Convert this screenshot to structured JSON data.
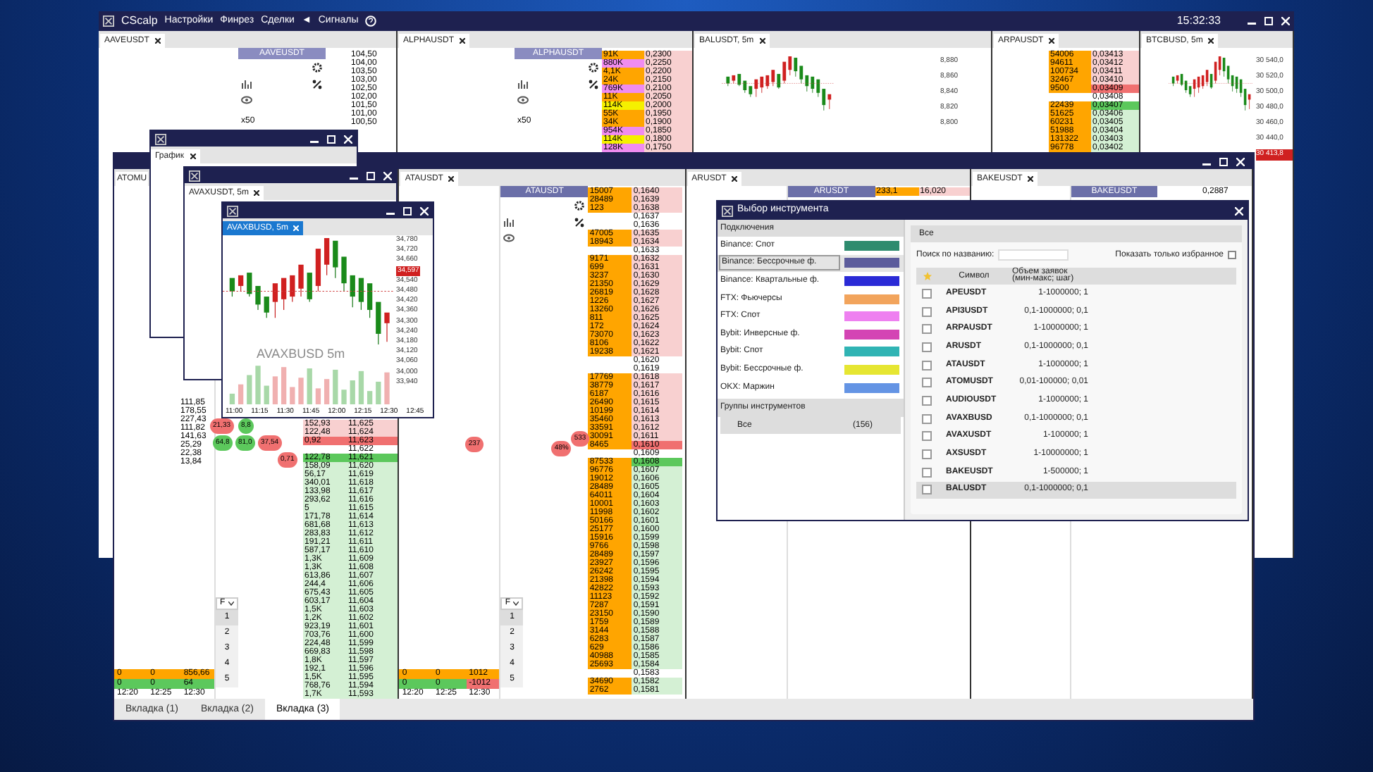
{
  "app": {
    "title": "CScalp",
    "menu": [
      "Настройки",
      "Финрез",
      "Сделки",
      "◄",
      "Сигналы"
    ],
    "time": "15:32:33"
  },
  "back_panes": [
    {
      "tab": "AAVEUSDT",
      "header": "AAVEUSDT",
      "multiplier": "x50",
      "prices": [
        "104,50",
        "104,00",
        "103,50",
        "103,00",
        "102,50",
        "102,00",
        "101,50",
        "101,00",
        "100,50"
      ]
    },
    {
      "tab": "ALPHAUSDT",
      "header": "ALPHAUSDT",
      "multiplier": "x50",
      "book": [
        {
          "volume": "91K",
          "price": "0,2300",
          "kind": "ask",
          "color": "#ffa500"
        },
        {
          "volume": "880K",
          "price": "0,2250",
          "kind": "ask",
          "color": "#f08cf0"
        },
        {
          "volume": "4,1K",
          "price": "0,2200",
          "kind": "ask",
          "color": "#ffa500"
        },
        {
          "volume": "24K",
          "price": "0,2150",
          "kind": "ask",
          "color": "#ffa500"
        },
        {
          "volume": "769K",
          "price": "0,2100",
          "kind": "ask",
          "color": "#f08cf0"
        },
        {
          "volume": "11K",
          "price": "0,2050",
          "kind": "ask",
          "color": "#ffa500"
        },
        {
          "volume": "114K",
          "price": "0,2000",
          "kind": "ask",
          "color": "#f5f000"
        },
        {
          "volume": "55K",
          "price": "0,1950",
          "kind": "ask",
          "color": "#ffa500"
        },
        {
          "volume": "34K",
          "price": "0,1900",
          "kind": "ask",
          "color": "#ffa500"
        },
        {
          "volume": "954K",
          "price": "0,1850",
          "kind": "ask",
          "color": "#f08cf0"
        },
        {
          "volume": "114K",
          "price": "0,1800",
          "kind": "ask",
          "color": "#f5f000"
        },
        {
          "volume": "128K",
          "price": "0,1750",
          "kind": "ask",
          "color": "#f08cf0"
        }
      ]
    },
    {
      "tab": "BALUSDT, 5m",
      "axis": [
        "8,880",
        "8,860",
        "8,840",
        "8,820",
        "8,800"
      ]
    },
    {
      "tab": "ARPAUSDT",
      "book": [
        {
          "volume": "54006",
          "price": "0,03413",
          "kind": "ask",
          "color": "#ffa500"
        },
        {
          "volume": "94611",
          "price": "0,03412",
          "kind": "ask",
          "color": "#ffa500"
        },
        {
          "volume": "100734",
          "price": "0,03411",
          "kind": "ask",
          "color": "#ffa500"
        },
        {
          "volume": "32467",
          "price": "0,03410",
          "kind": "ask",
          "color": "#ffa500"
        },
        {
          "volume": "9500",
          "price": "0,03409",
          "kind": "best_ask",
          "color": "#ffa500"
        },
        {
          "price": "0,03408",
          "kind": "empty"
        },
        {
          "volume": "22439",
          "price": "0,03407",
          "kind": "best_bid",
          "color": "#ffa500"
        },
        {
          "volume": "51625",
          "price": "0,03406",
          "kind": "bid",
          "color": "#ffa500"
        },
        {
          "volume": "60231",
          "price": "0,03405",
          "kind": "bid",
          "color": "#ffa500"
        },
        {
          "volume": "51988",
          "price": "0,03404",
          "kind": "bid",
          "color": "#ffa500"
        },
        {
          "volume": "131322",
          "price": "0,03403",
          "kind": "bid",
          "color": "#ffa500"
        },
        {
          "volume": "96778",
          "price": "0,03402",
          "kind": "bid",
          "color": "#ffa500"
        }
      ]
    },
    {
      "tab": "BTCBUSD, 5m",
      "axis": [
        "30 540,0",
        "30 520,0",
        "30 500,0",
        "30 480,0",
        "30 460,0",
        "30 440,0"
      ],
      "marker": "30 413,8"
    }
  ],
  "front_panes": [
    {
      "tab": "ATOMU",
      "filter": "F",
      "levels": [
        "1",
        "2",
        "3",
        "4",
        "5"
      ],
      "stats": [
        "111,85",
        "178,55",
        "227,43",
        "111,82",
        "141,63",
        "25,29",
        "22,38",
        "13,84"
      ],
      "bubbles": [
        {
          "text": "21,33",
          "color": "#f07070"
        },
        {
          "text": "64,8",
          "color": "#5cc85c"
        },
        {
          "text": "81,0",
          "color": "#5cc85c"
        },
        {
          "text": "8,8",
          "color": "#5cc85c"
        },
        {
          "text": "37,54",
          "color": "#f07070"
        },
        {
          "text": "0,71",
          "color": "#f07070"
        }
      ],
      "cluster": [
        {
          "kind": "sell",
          "values": [
            "0",
            "0",
            "856,66"
          ]
        },
        {
          "kind": "buy",
          "values": [
            "0",
            "0",
            "64"
          ]
        }
      ],
      "times": [
        "12:20",
        "12:25",
        "12:30"
      ],
      "book": [
        {
          "volume": "152,93",
          "price": "11,625",
          "kind": "ask"
        },
        {
          "volume": "122,48",
          "price": "11,624",
          "kind": "ask"
        },
        {
          "volume": "0,92",
          "price": "11,623",
          "kind": "best_ask"
        },
        {
          "price": "11,622",
          "kind": "empty"
        },
        {
          "volume": "122,78",
          "price": "11,621",
          "kind": "best_bid"
        },
        {
          "volume": "158,09",
          "price": "11,620",
          "kind": "bid"
        },
        {
          "volume": "56,17",
          "price": "11,619",
          "kind": "bid"
        },
        {
          "volume": "340,01",
          "price": "11,618",
          "kind": "bid"
        },
        {
          "volume": "133,98",
          "price": "11,617",
          "kind": "bid"
        },
        {
          "volume": "293,62",
          "price": "11,616",
          "kind": "bid"
        },
        {
          "volume": "5",
          "price": "11,615",
          "kind": "bid"
        },
        {
          "volume": "171,78",
          "price": "11,614",
          "kind": "bid"
        },
        {
          "volume": "681,68",
          "price": "11,613",
          "kind": "bid"
        },
        {
          "volume": "283,83",
          "price": "11,612",
          "kind": "bid"
        },
        {
          "volume": "191,21",
          "price": "11,611",
          "kind": "bid"
        },
        {
          "volume": "587,17",
          "price": "11,610",
          "kind": "bid"
        },
        {
          "volume": "1,3K",
          "price": "11,609",
          "kind": "bid"
        },
        {
          "volume": "1,3K",
          "price": "11,608",
          "kind": "bid"
        },
        {
          "volume": "613,86",
          "price": "11,607",
          "kind": "bid"
        },
        {
          "volume": "244,4",
          "price": "11,606",
          "kind": "bid"
        },
        {
          "volume": "675,43",
          "price": "11,605",
          "kind": "bid"
        },
        {
          "volume": "603,17",
          "price": "11,604",
          "kind": "bid"
        },
        {
          "volume": "1,5K",
          "price": "11,603",
          "kind": "bid"
        },
        {
          "volume": "1,2K",
          "price": "11,602",
          "kind": "bid"
        },
        {
          "volume": "923,19",
          "price": "11,601",
          "kind": "bid"
        },
        {
          "volume": "703,76",
          "price": "11,600",
          "kind": "bid"
        },
        {
          "volume": "224,48",
          "price": "11,599",
          "kind": "bid"
        },
        {
          "volume": "669,83",
          "price": "11,598",
          "kind": "bid"
        },
        {
          "volume": "1,8K",
          "price": "11,597",
          "kind": "bid"
        },
        {
          "volume": "192,1",
          "price": "11,596",
          "kind": "bid"
        },
        {
          "volume": "1,5K",
          "price": "11,595",
          "kind": "bid"
        },
        {
          "volume": "768,76",
          "price": "11,594",
          "kind": "bid"
        },
        {
          "volume": "1,7K",
          "price": "11,593",
          "kind": "bid"
        }
      ]
    },
    {
      "tab": "ATAUSDT",
      "header": "ATAUSDT",
      "filter": "F",
      "levels": [
        "1",
        "2",
        "3",
        "4",
        "5"
      ],
      "cluster": [
        {
          "kind": "sell",
          "values": [
            "0",
            "0",
            "1012"
          ]
        },
        {
          "kind": "buy",
          "values": [
            "0",
            "0",
            "-1012"
          ]
        }
      ],
      "times": [
        "12:20",
        "12:25",
        "12:30"
      ],
      "bubbles": [
        {
          "text": "237",
          "color": "#f07070"
        },
        {
          "text": "48%",
          "color": "#f07070"
        },
        {
          "text": "533",
          "color": "#f07070"
        }
      ],
      "book": [
        {
          "volume": "15007",
          "price": "0,1640",
          "kind": "ask",
          "color": "#ffa500"
        },
        {
          "volume": "28489",
          "price": "0,1639",
          "kind": "ask",
          "color": "#ffa500"
        },
        {
          "volume": "123",
          "price": "0,1638",
          "kind": "ask",
          "color": "#ffa500"
        },
        {
          "price": "0,1637",
          "kind": "empty"
        },
        {
          "price": "0,1636",
          "kind": "empty"
        },
        {
          "volume": "47005",
          "price": "0,1635",
          "kind": "ask",
          "color": "#ffa500"
        },
        {
          "volume": "18943",
          "price": "0,1634",
          "kind": "ask",
          "color": "#ffa500"
        },
        {
          "price": "0,1633",
          "kind": "empty"
        },
        {
          "volume": "9171",
          "price": "0,1632",
          "kind": "ask",
          "color": "#ffa500"
        },
        {
          "volume": "699",
          "price": "0,1631",
          "kind": "ask",
          "color": "#ffa500"
        },
        {
          "volume": "3237",
          "price": "0,1630",
          "kind": "ask",
          "color": "#ffa500"
        },
        {
          "volume": "21350",
          "price": "0,1629",
          "kind": "ask",
          "color": "#ffa500"
        },
        {
          "volume": "26819",
          "price": "0,1628",
          "kind": "ask",
          "color": "#ffa500"
        },
        {
          "volume": "1226",
          "price": "0,1627",
          "kind": "ask",
          "color": "#ffa500"
        },
        {
          "volume": "13260",
          "price": "0,1626",
          "kind": "ask",
          "color": "#ffa500"
        },
        {
          "volume": "811",
          "price": "0,1625",
          "kind": "ask",
          "color": "#ffa500"
        },
        {
          "volume": "172",
          "price": "0,1624",
          "kind": "ask",
          "color": "#ffa500"
        },
        {
          "volume": "73070",
          "price": "0,1623",
          "kind": "ask",
          "color": "#ffa500"
        },
        {
          "volume": "8106",
          "price": "0,1622",
          "kind": "ask",
          "color": "#ffa500"
        },
        {
          "volume": "19238",
          "price": "0,1621",
          "kind": "ask",
          "color": "#ffa500"
        },
        {
          "price": "0,1620",
          "kind": "empty"
        },
        {
          "price": "0,1619",
          "kind": "empty"
        },
        {
          "volume": "17769",
          "price": "0,1618",
          "kind": "ask",
          "color": "#ffa500"
        },
        {
          "volume": "38779",
          "price": "0,1617",
          "kind": "ask",
          "color": "#ffa500"
        },
        {
          "volume": "6187",
          "price": "0,1616",
          "kind": "ask",
          "color": "#ffa500"
        },
        {
          "volume": "26490",
          "price": "0,1615",
          "kind": "ask",
          "color": "#ffa500"
        },
        {
          "volume": "10199",
          "price": "0,1614",
          "kind": "ask",
          "color": "#ffa500"
        },
        {
          "volume": "35460",
          "price": "0,1613",
          "kind": "ask",
          "color": "#ffa500"
        },
        {
          "volume": "33591",
          "price": "0,1612",
          "kind": "ask",
          "color": "#ffa500"
        },
        {
          "volume": "30091",
          "price": "0,1611",
          "kind": "ask",
          "color": "#ffa500"
        },
        {
          "volume": "8465",
          "price": "0,1610",
          "kind": "best_ask",
          "color": "#ffa500"
        },
        {
          "price": "0,1609",
          "kind": "empty"
        },
        {
          "volume": "87533",
          "price": "0,1608",
          "kind": "best_bid",
          "color": "#ffa500"
        },
        {
          "volume": "96776",
          "price": "0,1607",
          "kind": "bid",
          "color": "#ffa500"
        },
        {
          "volume": "19012",
          "price": "0,1606",
          "kind": "bid",
          "color": "#ffa500"
        },
        {
          "volume": "28489",
          "price": "0,1605",
          "kind": "bid",
          "color": "#ffa500"
        },
        {
          "volume": "64011",
          "price": "0,1604",
          "kind": "bid",
          "color": "#ffa500"
        },
        {
          "volume": "10001",
          "price": "0,1603",
          "kind": "bid",
          "color": "#ffa500"
        },
        {
          "volume": "11998",
          "price": "0,1602",
          "kind": "bid",
          "color": "#ffa500"
        },
        {
          "volume": "50166",
          "price": "0,1601",
          "kind": "bid",
          "color": "#ffa500"
        },
        {
          "volume": "25177",
          "price": "0,1600",
          "kind": "bid",
          "color": "#ffa500"
        },
        {
          "volume": "15916",
          "price": "0,1599",
          "kind": "bid",
          "color": "#ffa500"
        },
        {
          "volume": "9766",
          "price": "0,1598",
          "kind": "bid",
          "color": "#ffa500"
        },
        {
          "volume": "28489",
          "price": "0,1597",
          "kind": "bid",
          "color": "#ffa500"
        },
        {
          "volume": "23927",
          "price": "0,1596",
          "kind": "bid",
          "color": "#ffa500"
        },
        {
          "volume": "26242",
          "price": "0,1595",
          "kind": "bid",
          "color": "#ffa500"
        },
        {
          "volume": "21398",
          "price": "0,1594",
          "kind": "bid",
          "color": "#ffa500"
        },
        {
          "volume": "42822",
          "price": "0,1593",
          "kind": "bid",
          "color": "#ffa500"
        },
        {
          "volume": "11123",
          "price": "0,1592",
          "kind": "bid",
          "color": "#ffa500"
        },
        {
          "volume": "7287",
          "price": "0,1591",
          "kind": "bid",
          "color": "#ffa500"
        },
        {
          "volume": "23150",
          "price": "0,1590",
          "kind": "bid",
          "color": "#ffa500"
        },
        {
          "volume": "1759",
          "price": "0,1589",
          "kind": "bid",
          "color": "#ffa500"
        },
        {
          "volume": "3144",
          "price": "0,1588",
          "kind": "bid",
          "color": "#ffa500"
        },
        {
          "volume": "6283",
          "price": "0,1587",
          "kind": "bid",
          "color": "#ffa500"
        },
        {
          "volume": "629",
          "price": "0,1586",
          "kind": "bid",
          "color": "#ffa500"
        },
        {
          "volume": "40988",
          "price": "0,1585",
          "kind": "bid",
          "color": "#ffa500"
        },
        {
          "volume": "25693",
          "price": "0,1584",
          "kind": "bid",
          "color": "#ffa500"
        },
        {
          "price": "0,1583",
          "kind": "empty"
        },
        {
          "volume": "34690",
          "price": "0,1582",
          "kind": "bid",
          "color": "#ffa500"
        },
        {
          "volume": "2762",
          "price": "0,1581",
          "kind": "bid",
          "color": "#ffa500"
        }
      ]
    },
    {
      "tab": "ARUSDT",
      "header": "ARUSDT",
      "book": [
        {
          "volume": "233,1",
          "price": "16,020",
          "kind": "ask",
          "color": "#ffa500"
        }
      ]
    },
    {
      "tab": "BAKEUSDT",
      "header": "BAKEUSDT",
      "book": [
        {
          "price": "0,2887",
          "kind": "empty"
        }
      ]
    }
  ],
  "bottom_tabs": [
    {
      "label": "Вкладка (1)",
      "selected": false
    },
    {
      "label": "Вкладка (2)",
      "selected": false
    },
    {
      "label": "Вкладка (3)",
      "selected": true
    }
  ],
  "chart_windows": [
    {
      "tab": "График"
    },
    {
      "tab": "AVAXUSDT, 5m"
    },
    {
      "tab": "AVAXBUSD, 5m",
      "watermark": "AVAXBUSD 5m",
      "axis": [
        "34,780",
        "34,720",
        "34,660",
        "34,540",
        "34,480",
        "34,420",
        "34,360",
        "34,300",
        "34,240",
        "34,180",
        "34,120",
        "34,060",
        "34,000",
        "33,940"
      ],
      "marker": "34,597",
      "times": [
        "11:00",
        "11:15",
        "11:30",
        "11:45",
        "12:00",
        "12:15",
        "12:30",
        "12:45"
      ]
    }
  ],
  "dialog": {
    "title": "Выбор инструмента",
    "connections_header": "Подключения",
    "connections": [
      {
        "name": "Binance: Спот",
        "color": "#2e8b6e",
        "selected": false
      },
      {
        "name": "Binance: Бессрочные ф.",
        "color": "#5c5c9c",
        "selected": true
      },
      {
        "name": "Binance: Квартальные ф.",
        "color": "#2a2ad6",
        "selected": false
      },
      {
        "name": "FTX: Фьючерсы",
        "color": "#f2a45c",
        "selected": false
      },
      {
        "name": "FTX: Спот",
        "color": "#ee80f0",
        "selected": false
      },
      {
        "name": "Bybit: Инверсные ф.",
        "color": "#d444b4",
        "selected": false
      },
      {
        "name": "Bybit: Спот",
        "color": "#30b4b4",
        "selected": false
      },
      {
        "name": "Bybit: Бессрочные ф.",
        "color": "#e6e632",
        "selected": false
      },
      {
        "name": "OKX: Маржин",
        "color": "#6494e4",
        "selected": false
      }
    ],
    "groups_header": "Группы инструментов",
    "groups": [
      {
        "name": "Все",
        "count": "(156)",
        "selected": true
      }
    ],
    "tab": "Все",
    "search_label": "Поиск по названию:",
    "favorites_label": "Показать только избранное",
    "favorites_only": false,
    "columns": [
      "Символ",
      "Объем заявок (мин-макс; шаг)"
    ],
    "instruments": [
      {
        "symbol": "APEUSDT",
        "volume": "1-1000000; 1",
        "checked": false,
        "selected": false
      },
      {
        "symbol": "API3USDT",
        "volume": "0,1-1000000; 0,1",
        "checked": false,
        "selected": false
      },
      {
        "symbol": "ARPAUSDT",
        "volume": "1-10000000; 1",
        "checked": false,
        "selected": false
      },
      {
        "symbol": "ARUSDT",
        "volume": "0,1-1000000; 0,1",
        "checked": false,
        "selected": false
      },
      {
        "symbol": "ATAUSDT",
        "volume": "1-1000000; 1",
        "checked": false,
        "selected": false
      },
      {
        "symbol": "ATOMUSDT",
        "volume": "0,01-100000; 0,01",
        "checked": false,
        "selected": false
      },
      {
        "symbol": "AUDIOUSDT",
        "volume": "1-1000000; 1",
        "checked": false,
        "selected": false
      },
      {
        "symbol": "AVAXBUSD",
        "volume": "0,1-1000000; 0,1",
        "checked": false,
        "selected": false
      },
      {
        "symbol": "AVAXUSDT",
        "volume": "1-100000; 1",
        "checked": false,
        "selected": false
      },
      {
        "symbol": "AXSUSDT",
        "volume": "1-10000000; 1",
        "checked": false,
        "selected": false
      },
      {
        "symbol": "BAKEUSDT",
        "volume": "1-500000; 1",
        "checked": false,
        "selected": false
      },
      {
        "symbol": "BALUSDT",
        "volume": "0,1-1000000; 0,1",
        "checked": false,
        "selected": true
      }
    ]
  }
}
